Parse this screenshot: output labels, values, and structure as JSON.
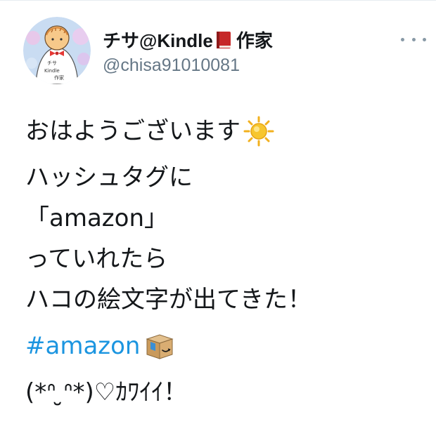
{
  "user": {
    "display_name": "チサ@Kindle",
    "display_name_suffix": "作家",
    "handle": "@chisa91010081",
    "avatar_text": [
      "チサ",
      "Kindle",
      "作家"
    ]
  },
  "tweet": {
    "lines": [
      "おはようございます",
      "ハッシュタグに",
      "「amazon」",
      "っていれたら",
      "ハコの絵文字が出てきた！"
    ],
    "hashtag": "#amazon",
    "last_line": "(*ᐢ ̮ᐢ*)♡ｶﾜｲｲ！"
  },
  "icons": {
    "book": "red-book-icon",
    "sun": "sun-icon",
    "box": "amazon-box-icon",
    "more": "more-icon"
  },
  "colors": {
    "hashtag": "#1b95e0",
    "handle": "#657786",
    "text": "#14171a"
  }
}
